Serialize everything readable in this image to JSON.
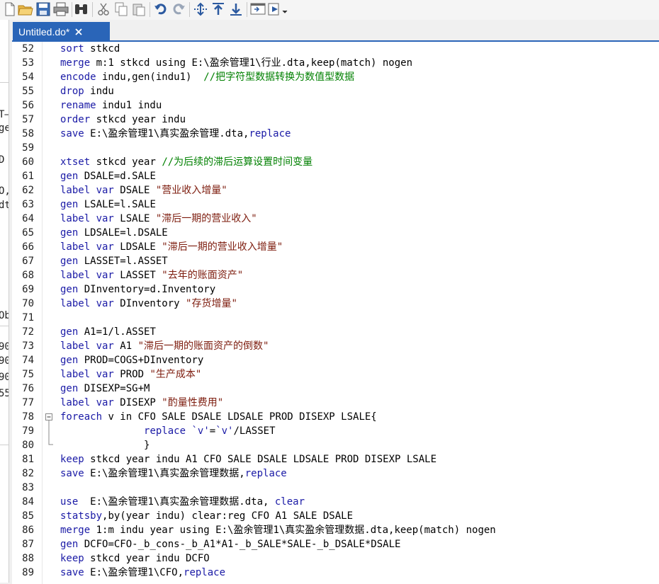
{
  "toolbar": {
    "buttons": [
      {
        "name": "new-file-icon"
      },
      {
        "name": "open-folder-icon"
      },
      {
        "name": "save-icon"
      },
      {
        "name": "print-icon"
      },
      {
        "name": "find-icon"
      },
      {
        "name": "cut-icon"
      },
      {
        "name": "copy-icon"
      },
      {
        "name": "paste-icon"
      },
      {
        "name": "undo-icon"
      },
      {
        "name": "redo-icon"
      },
      {
        "name": "indent-icon"
      },
      {
        "name": "run-selection-up-icon"
      },
      {
        "name": "run-selection-down-icon"
      },
      {
        "name": "show-results-icon"
      },
      {
        "name": "execute-do-icon"
      }
    ]
  },
  "tab": {
    "title": "Untitled.do*"
  },
  "colors": {
    "accent": "#2a65b8",
    "keyword": "#1a1aa6",
    "string": "#7d1c0e",
    "comment": "#008000",
    "text": "#000000"
  },
  "left_strip_fragments": [
    "T–",
    "ge",
    "D",
    "O,",
    "dt",
    "Ob",
    "90",
    "90",
    "90",
    "55"
  ],
  "editor": {
    "lines": [
      {
        "num": "52",
        "tokens": [
          {
            "t": "kw",
            "v": "sort"
          },
          {
            "t": "n",
            "v": " stkcd"
          }
        ]
      },
      {
        "num": "53",
        "tokens": [
          {
            "t": "kw",
            "v": "merge"
          },
          {
            "t": "n",
            "v": " m:1 stkcd using E:\\盈余管理1\\行业.dta,keep(match) nogen"
          }
        ]
      },
      {
        "num": "54",
        "tokens": [
          {
            "t": "kw",
            "v": "encode"
          },
          {
            "t": "n",
            "v": " indu,gen(indu1)  "
          },
          {
            "t": "cmt",
            "v": "//把字符型数据转换为数值型数据"
          }
        ]
      },
      {
        "num": "55",
        "tokens": [
          {
            "t": "kw",
            "v": "drop"
          },
          {
            "t": "n",
            "v": " indu"
          }
        ]
      },
      {
        "num": "56",
        "tokens": [
          {
            "t": "kw",
            "v": "rename"
          },
          {
            "t": "n",
            "v": " indu1 indu"
          }
        ]
      },
      {
        "num": "57",
        "tokens": [
          {
            "t": "kw",
            "v": "order"
          },
          {
            "t": "n",
            "v": " stkcd year indu"
          }
        ]
      },
      {
        "num": "58",
        "tokens": [
          {
            "t": "kw",
            "v": "save"
          },
          {
            "t": "n",
            "v": " E:\\盈余管理1\\真实盈余管理.dta,"
          },
          {
            "t": "kw",
            "v": "replace"
          }
        ]
      },
      {
        "num": "59",
        "tokens": []
      },
      {
        "num": "60",
        "tokens": [
          {
            "t": "kw",
            "v": "xtset"
          },
          {
            "t": "n",
            "v": " stkcd year "
          },
          {
            "t": "cmt",
            "v": "//为后续的滞后运算设置时间变量"
          }
        ]
      },
      {
        "num": "61",
        "tokens": [
          {
            "t": "kw",
            "v": "gen"
          },
          {
            "t": "n",
            "v": " DSALE=d.SALE"
          }
        ]
      },
      {
        "num": "62",
        "tokens": [
          {
            "t": "kw",
            "v": "label var"
          },
          {
            "t": "n",
            "v": " DSALE "
          },
          {
            "t": "str",
            "v": "\"营业收入增量\""
          }
        ]
      },
      {
        "num": "63",
        "tokens": [
          {
            "t": "kw",
            "v": "gen"
          },
          {
            "t": "n",
            "v": " LSALE=l.SALE"
          }
        ]
      },
      {
        "num": "64",
        "tokens": [
          {
            "t": "kw",
            "v": "label var"
          },
          {
            "t": "n",
            "v": " LSALE "
          },
          {
            "t": "str",
            "v": "\"滞后一期的营业收入\""
          }
        ]
      },
      {
        "num": "65",
        "tokens": [
          {
            "t": "kw",
            "v": "gen"
          },
          {
            "t": "n",
            "v": " LDSALE=l.DSALE"
          }
        ]
      },
      {
        "num": "66",
        "tokens": [
          {
            "t": "kw",
            "v": "label var"
          },
          {
            "t": "n",
            "v": " LDSALE "
          },
          {
            "t": "str",
            "v": "\"滞后一期的营业收入增量\""
          }
        ]
      },
      {
        "num": "67",
        "tokens": [
          {
            "t": "kw",
            "v": "gen"
          },
          {
            "t": "n",
            "v": " LASSET=l.ASSET"
          }
        ]
      },
      {
        "num": "68",
        "tokens": [
          {
            "t": "kw",
            "v": "label var"
          },
          {
            "t": "n",
            "v": " LASSET "
          },
          {
            "t": "str",
            "v": "\"去年的账面资产\""
          }
        ]
      },
      {
        "num": "69",
        "tokens": [
          {
            "t": "kw",
            "v": "gen"
          },
          {
            "t": "n",
            "v": " DInventory=d.Inventory"
          }
        ]
      },
      {
        "num": "70",
        "tokens": [
          {
            "t": "kw",
            "v": "label var"
          },
          {
            "t": "n",
            "v": " DInventory "
          },
          {
            "t": "str",
            "v": "\"存货增量\""
          }
        ]
      },
      {
        "num": "71",
        "tokens": []
      },
      {
        "num": "72",
        "tokens": [
          {
            "t": "kw",
            "v": "gen"
          },
          {
            "t": "n",
            "v": " A1=1/l.ASSET"
          }
        ]
      },
      {
        "num": "73",
        "tokens": [
          {
            "t": "kw",
            "v": "label var"
          },
          {
            "t": "n",
            "v": " A1 "
          },
          {
            "t": "str",
            "v": "\"滞后一期的账面资产的倒数\""
          }
        ]
      },
      {
        "num": "74",
        "tokens": [
          {
            "t": "kw",
            "v": "gen"
          },
          {
            "t": "n",
            "v": " PROD=COGS+DInventory"
          }
        ]
      },
      {
        "num": "75",
        "tokens": [
          {
            "t": "kw",
            "v": "label var"
          },
          {
            "t": "n",
            "v": " PROD "
          },
          {
            "t": "str",
            "v": "\"生产成本\""
          }
        ]
      },
      {
        "num": "76",
        "tokens": [
          {
            "t": "kw",
            "v": "gen"
          },
          {
            "t": "n",
            "v": " DISEXP=SG+M"
          }
        ]
      },
      {
        "num": "77",
        "tokens": [
          {
            "t": "kw",
            "v": "label var"
          },
          {
            "t": "n",
            "v": " DISEXP "
          },
          {
            "t": "str",
            "v": "\"酌量性费用\""
          }
        ]
      },
      {
        "num": "78",
        "tokens": [
          {
            "t": "kw",
            "v": "foreach"
          },
          {
            "t": "n",
            "v": " v in CFO SALE DSALE LDSALE PROD DISEXP LSALE{"
          }
        ]
      },
      {
        "num": "79",
        "tokens": [
          {
            "t": "n",
            "v": "              "
          },
          {
            "t": "kw",
            "v": "replace"
          },
          {
            "t": "n",
            "v": " "
          },
          {
            "t": "mac",
            "v": "`v'"
          },
          {
            "t": "n",
            "v": "="
          },
          {
            "t": "mac",
            "v": "`v'"
          },
          {
            "t": "n",
            "v": "/LASSET"
          }
        ]
      },
      {
        "num": "80",
        "tokens": [
          {
            "t": "n",
            "v": "              }"
          }
        ]
      },
      {
        "num": "81",
        "tokens": [
          {
            "t": "kw",
            "v": "keep"
          },
          {
            "t": "n",
            "v": " stkcd year indu A1 CFO SALE DSALE LDSALE PROD DISEXP LSALE"
          }
        ]
      },
      {
        "num": "82",
        "tokens": [
          {
            "t": "kw",
            "v": "save"
          },
          {
            "t": "n",
            "v": " E:\\盈余管理1\\真实盈余管理数据,"
          },
          {
            "t": "kw",
            "v": "replace"
          }
        ]
      },
      {
        "num": "83",
        "tokens": []
      },
      {
        "num": "84",
        "tokens": [
          {
            "t": "kw",
            "v": "use"
          },
          {
            "t": "n",
            "v": "  E:\\盈余管理1\\真实盈余管理数据.dta, "
          },
          {
            "t": "kw",
            "v": "clear"
          }
        ]
      },
      {
        "num": "85",
        "tokens": [
          {
            "t": "kw",
            "v": "statsby"
          },
          {
            "t": "n",
            "v": ",by(year indu) clear:reg CFO A1 SALE DSALE"
          }
        ]
      },
      {
        "num": "86",
        "tokens": [
          {
            "t": "kw",
            "v": "merge"
          },
          {
            "t": "n",
            "v": " 1:m indu year using E:\\盈余管理1\\真实盈余管理数据.dta,keep(match) nogen"
          }
        ]
      },
      {
        "num": "87",
        "tokens": [
          {
            "t": "kw",
            "v": "gen"
          },
          {
            "t": "n",
            "v": " DCFO=CFO-_b_cons-_b_A1*A1-_b_SALE*SALE-_b_DSALE*DSALE"
          }
        ]
      },
      {
        "num": "88",
        "tokens": [
          {
            "t": "kw",
            "v": "keep"
          },
          {
            "t": "n",
            "v": " stkcd year indu DCFO"
          }
        ]
      },
      {
        "num": "89",
        "tokens": [
          {
            "t": "kw",
            "v": "save"
          },
          {
            "t": "n",
            "v": " E:\\盈余管理1\\CFO,"
          },
          {
            "t": "kw",
            "v": "replace"
          }
        ]
      }
    ]
  }
}
